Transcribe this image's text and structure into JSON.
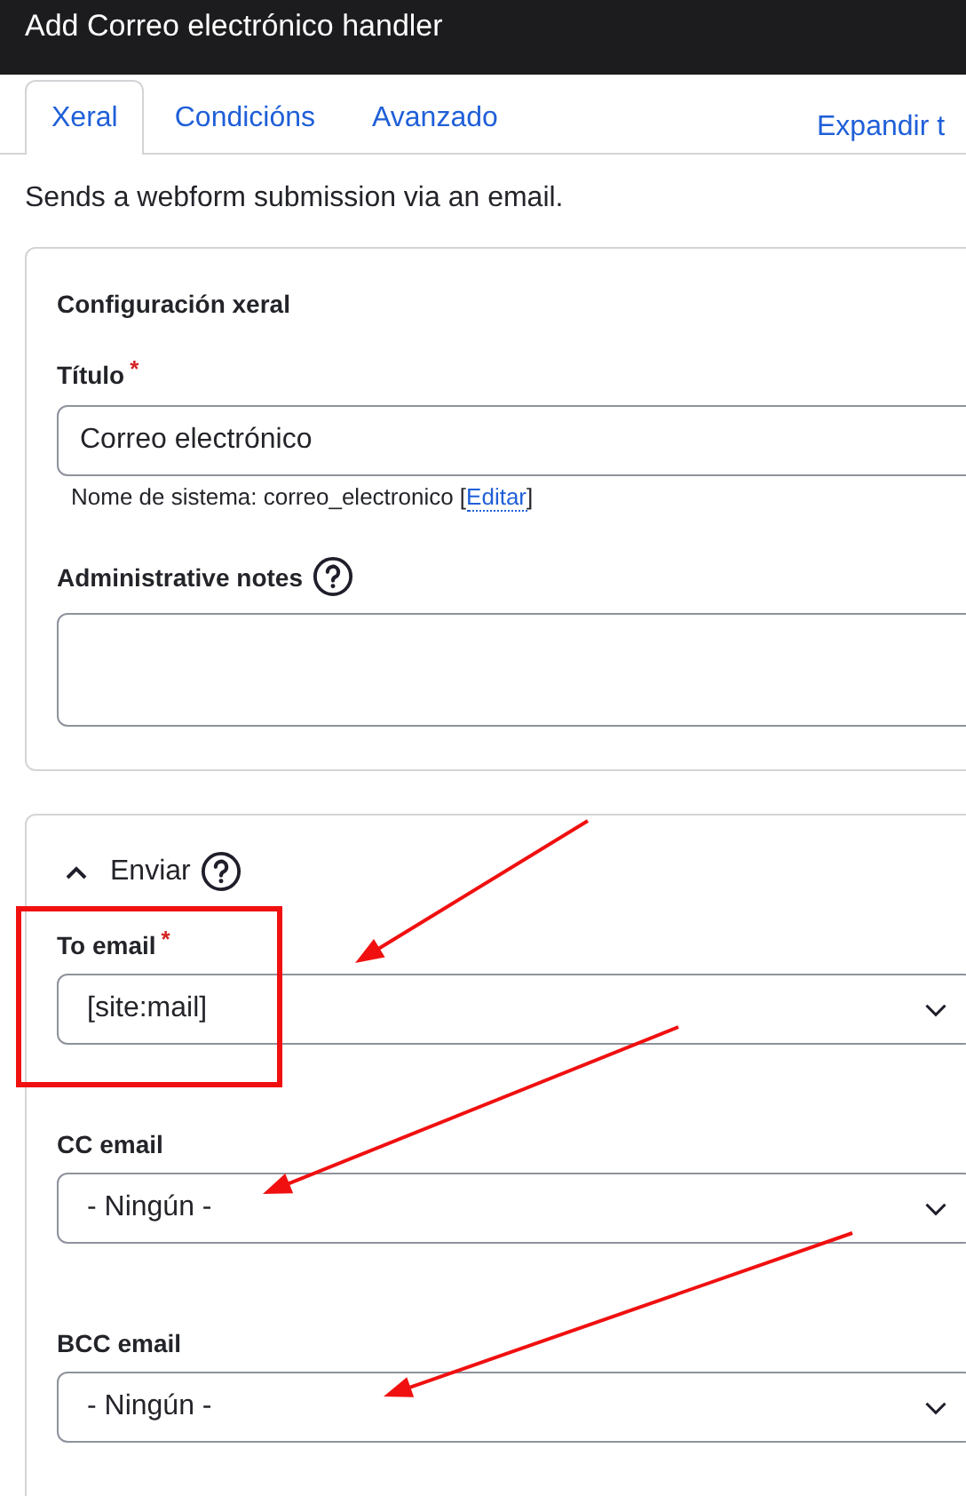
{
  "window": {
    "title": "Add Correo electrónico handler"
  },
  "tabs": [
    {
      "label": "Xeral",
      "selected": true
    },
    {
      "label": "Condicións",
      "selected": false
    },
    {
      "label": "Avanzado",
      "selected": false
    }
  ],
  "expand_link": "Expandir t",
  "description": "Sends a webform submission via an email.",
  "general": {
    "heading": "Configuración xeral",
    "title_field": {
      "label": "Título",
      "required_mark": "*",
      "value": "Correo electrónico"
    },
    "machine_name": {
      "text": "Nome de sistema: correo_electronico [",
      "link": "Editar",
      "end": "]"
    },
    "notes_field": {
      "label": "Administrative notes",
      "help": true
    }
  },
  "send": {
    "heading": "Enviar",
    "expanded": true,
    "help": true,
    "fields": [
      {
        "label": "To email",
        "required_mark": "*",
        "value": "[site:mail]",
        "highlighted": true,
        "arrow": true
      },
      {
        "label": "CC email",
        "value": "- Ningún -",
        "highlighted": false,
        "arrow": true
      },
      {
        "label": "BCC email",
        "value": "- Ningún -",
        "highlighted": false,
        "arrow": true
      }
    ]
  }
}
